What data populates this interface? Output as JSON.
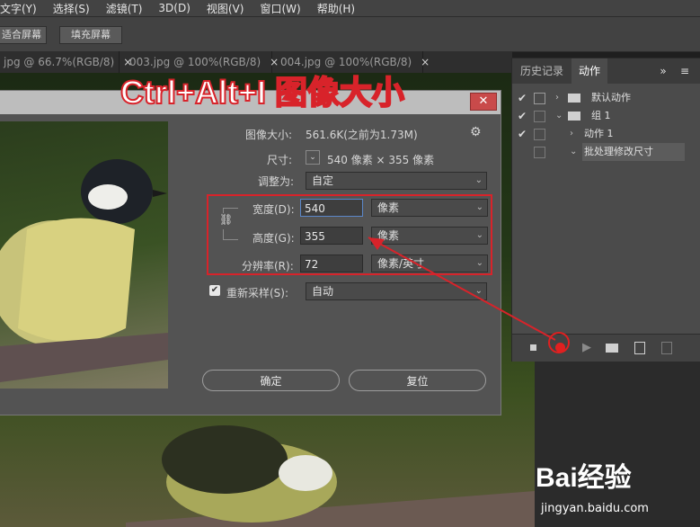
{
  "menu": [
    "文字(Y)",
    "选择(S)",
    "滤镜(T)",
    "3D(D)",
    "视图(V)",
    "窗口(W)",
    "帮助(H)"
  ],
  "options_bar": {
    "fit_screen": "适合屏幕",
    "fill_screen": "填充屏幕"
  },
  "tabs": [
    {
      "label": "jpg @ 66.7%(RGB/8)",
      "close": "×"
    },
    {
      "label": "003.jpg @ 100%(RGB/8)",
      "close": "×"
    },
    {
      "label": "004.jpg @ 100%(RGB/8)",
      "close": "×"
    }
  ],
  "overlay_title": "Ctrl+Alt+I 图像大小",
  "panel": {
    "tabs": [
      "历史记录",
      "动作"
    ],
    "menu_icon": "»",
    "rows": [
      {
        "label": "默认动作",
        "checked": true
      },
      {
        "label": "组 1",
        "checked": true
      },
      {
        "label": "动作 1",
        "checked": true
      },
      {
        "label": "批处理修改尺寸",
        "checked": false
      }
    ]
  },
  "dialog": {
    "close": "✕",
    "image_size_label": "图像大小:",
    "image_size_value": "561.6K(之前为1.73M)",
    "dimensions_label": "尺寸:",
    "dimensions_value": "540 像素 × 355 像素",
    "fit_to_label": "调整为:",
    "fit_to_value": "自定",
    "width_label": "宽度(D):",
    "width_value": "540",
    "width_unit": "像素",
    "height_label": "高度(G):",
    "height_value": "355",
    "height_unit": "像素",
    "resolution_label": "分辨率(R):",
    "resolution_value": "72",
    "resolution_unit": "像素/英寸",
    "resample_label": "重新采样(S):",
    "resample_value": "自动",
    "resample_checked": true,
    "ok_label": "确定",
    "reset_label": "复位"
  },
  "watermark": {
    "brand": "Bai经验",
    "url": "jingyan.baidu.com"
  },
  "colors": {
    "accent_red": "#d8232a",
    "record_red": "#e02020"
  }
}
